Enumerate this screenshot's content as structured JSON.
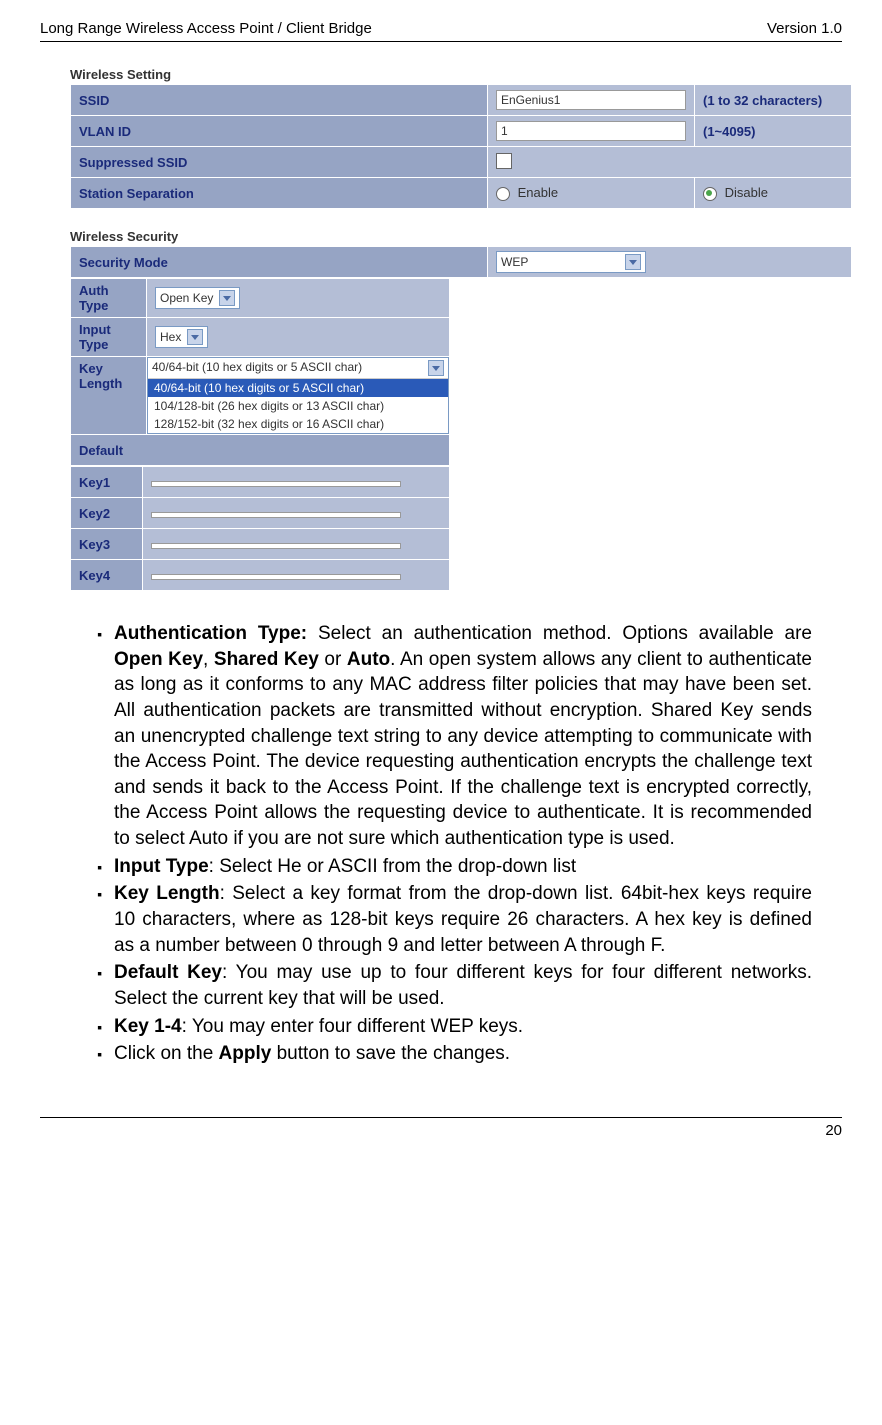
{
  "header": {
    "left": "Long Range Wireless Access Point / Client Bridge",
    "right": "Version 1.0"
  },
  "wireless_setting": {
    "title": "Wireless Setting",
    "rows": {
      "ssid_label": "SSID",
      "ssid_value": "EnGenius1",
      "ssid_hint": "(1 to 32 characters)",
      "vlan_label": "VLAN ID",
      "vlan_value": "1",
      "vlan_hint": "(1~4095)",
      "supp_label": "Suppressed SSID",
      "sep_label": "Station Separation",
      "sep_enable": "Enable",
      "sep_disable": "Disable"
    }
  },
  "wireless_security": {
    "title": "Wireless Security",
    "mode_label": "Security Mode",
    "mode_value": "WEP",
    "auth_label": "Auth Type",
    "auth_value": "Open Key",
    "input_label": "Input Type",
    "input_value": "Hex",
    "keylen_label": "Key Length",
    "keylen_selected": "40/64-bit (10 hex digits or 5 ASCII char)",
    "keylen_options": [
      "40/64-bit (10 hex digits or 5 ASCII char)",
      "104/128-bit (26 hex digits or 13 ASCII char)",
      "128/152-bit (32 hex digits or 16 ASCII char)"
    ],
    "default_label": "Default",
    "key1": "Key1",
    "key2": "Key2",
    "key3": "Key3",
    "key4": "Key4"
  },
  "bullets": {
    "auth_title": "Authentication Type:",
    "auth_body": " Select an authentication method. Options available are ",
    "auth_b1": "Open Key",
    "auth_sep1": ", ",
    "auth_b2": "Shared Key",
    "auth_sep2": " or ",
    "auth_b3": "Auto",
    "auth_rest": ". An open system allows any client to authenticate as long as it conforms to any MAC address filter policies that may have been set. All authentication packets are transmitted without encryption. Shared Key sends an unencrypted challenge text string to any device attempting to communicate with the Access Point. The device requesting authentication encrypts the challenge text and sends it back to the Access Point. If the challenge text is encrypted correctly, the Access Point allows the requesting device to authenticate. It is recommended to select Auto if you are not sure which authentication type is used.",
    "input_title": "Input Type",
    "input_body": ": Select He or ASCII from the drop-down list",
    "keylen_title": "Key Length",
    "keylen_body": ": Select a key format from the drop-down list. 64bit-hex keys require 10 characters, where as 128-bit keys require 26 characters. A hex key is defined as a number between 0 through 9 and letter between A through F.",
    "default_title": "Default Key",
    "default_body": ": You may use up to four different keys for four different networks. Select the current key that will be used.",
    "key14_title": "Key 1-4",
    "key14_body": ": You may enter four different WEP keys.",
    "apply_pre": "Click on the ",
    "apply_b": "Apply",
    "apply_post": " button to save the changes."
  },
  "footer": {
    "page": "20"
  }
}
